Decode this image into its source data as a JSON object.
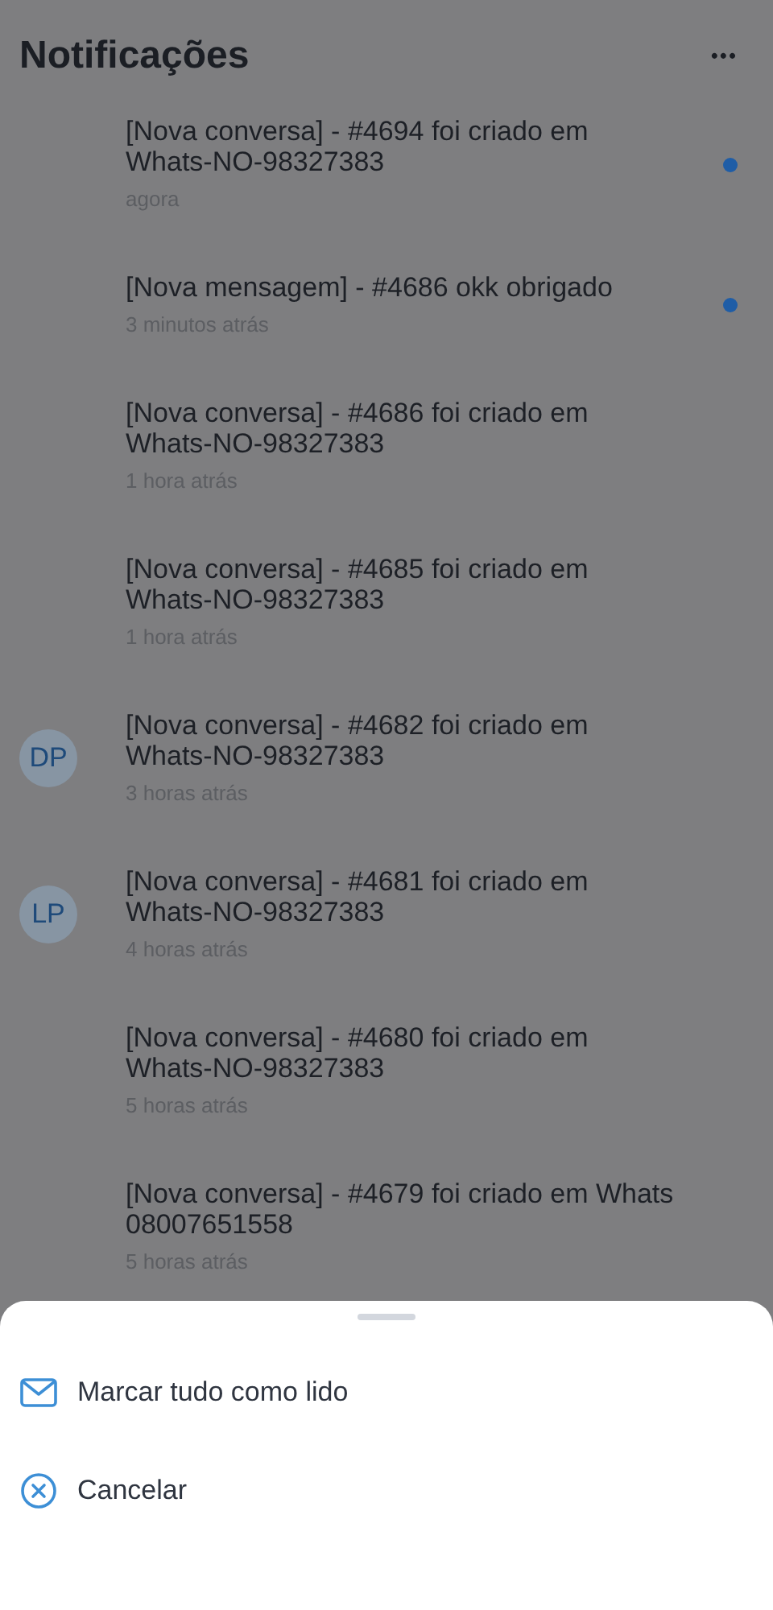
{
  "header": {
    "title": "Notificações",
    "menu": "•••"
  },
  "notifications": [
    {
      "text": "[Nova conversa] - #4694 foi criado em Whats-NO-98327383",
      "time": "agora",
      "unread": true
    },
    {
      "text": "[Nova mensagem] - #4686 okk obrigado",
      "time": "3 minutos atrás",
      "unread": true
    },
    {
      "text": "[Nova conversa] - #4686 foi criado em Whats-NO-98327383",
      "time": "1 hora atrás",
      "unread": false
    },
    {
      "text": "[Nova conversa] - #4685 foi criado em Whats-NO-98327383",
      "time": "1 hora atrás",
      "unread": false
    },
    {
      "text": "[Nova conversa] - #4682 foi criado em Whats-NO-98327383",
      "time": "3 horas atrás",
      "unread": false,
      "avatar": "DP"
    },
    {
      "text": "[Nova conversa] - #4681 foi criado em Whats-NO-98327383",
      "time": "4 horas atrás",
      "unread": false,
      "avatar": "LP"
    },
    {
      "text": "[Nova conversa] - #4680 foi criado em Whats-NO-98327383",
      "time": "5 horas atrás",
      "unread": false
    },
    {
      "text": "[Nova conversa] - #4679 foi criado em Whats 08007651558",
      "time": "5 horas atrás",
      "unread": false
    }
  ],
  "action_sheet": [
    {
      "kind": "mail",
      "label": "Marcar tudo como lido"
    },
    {
      "kind": "cancel",
      "label": "Cancelar"
    }
  ]
}
